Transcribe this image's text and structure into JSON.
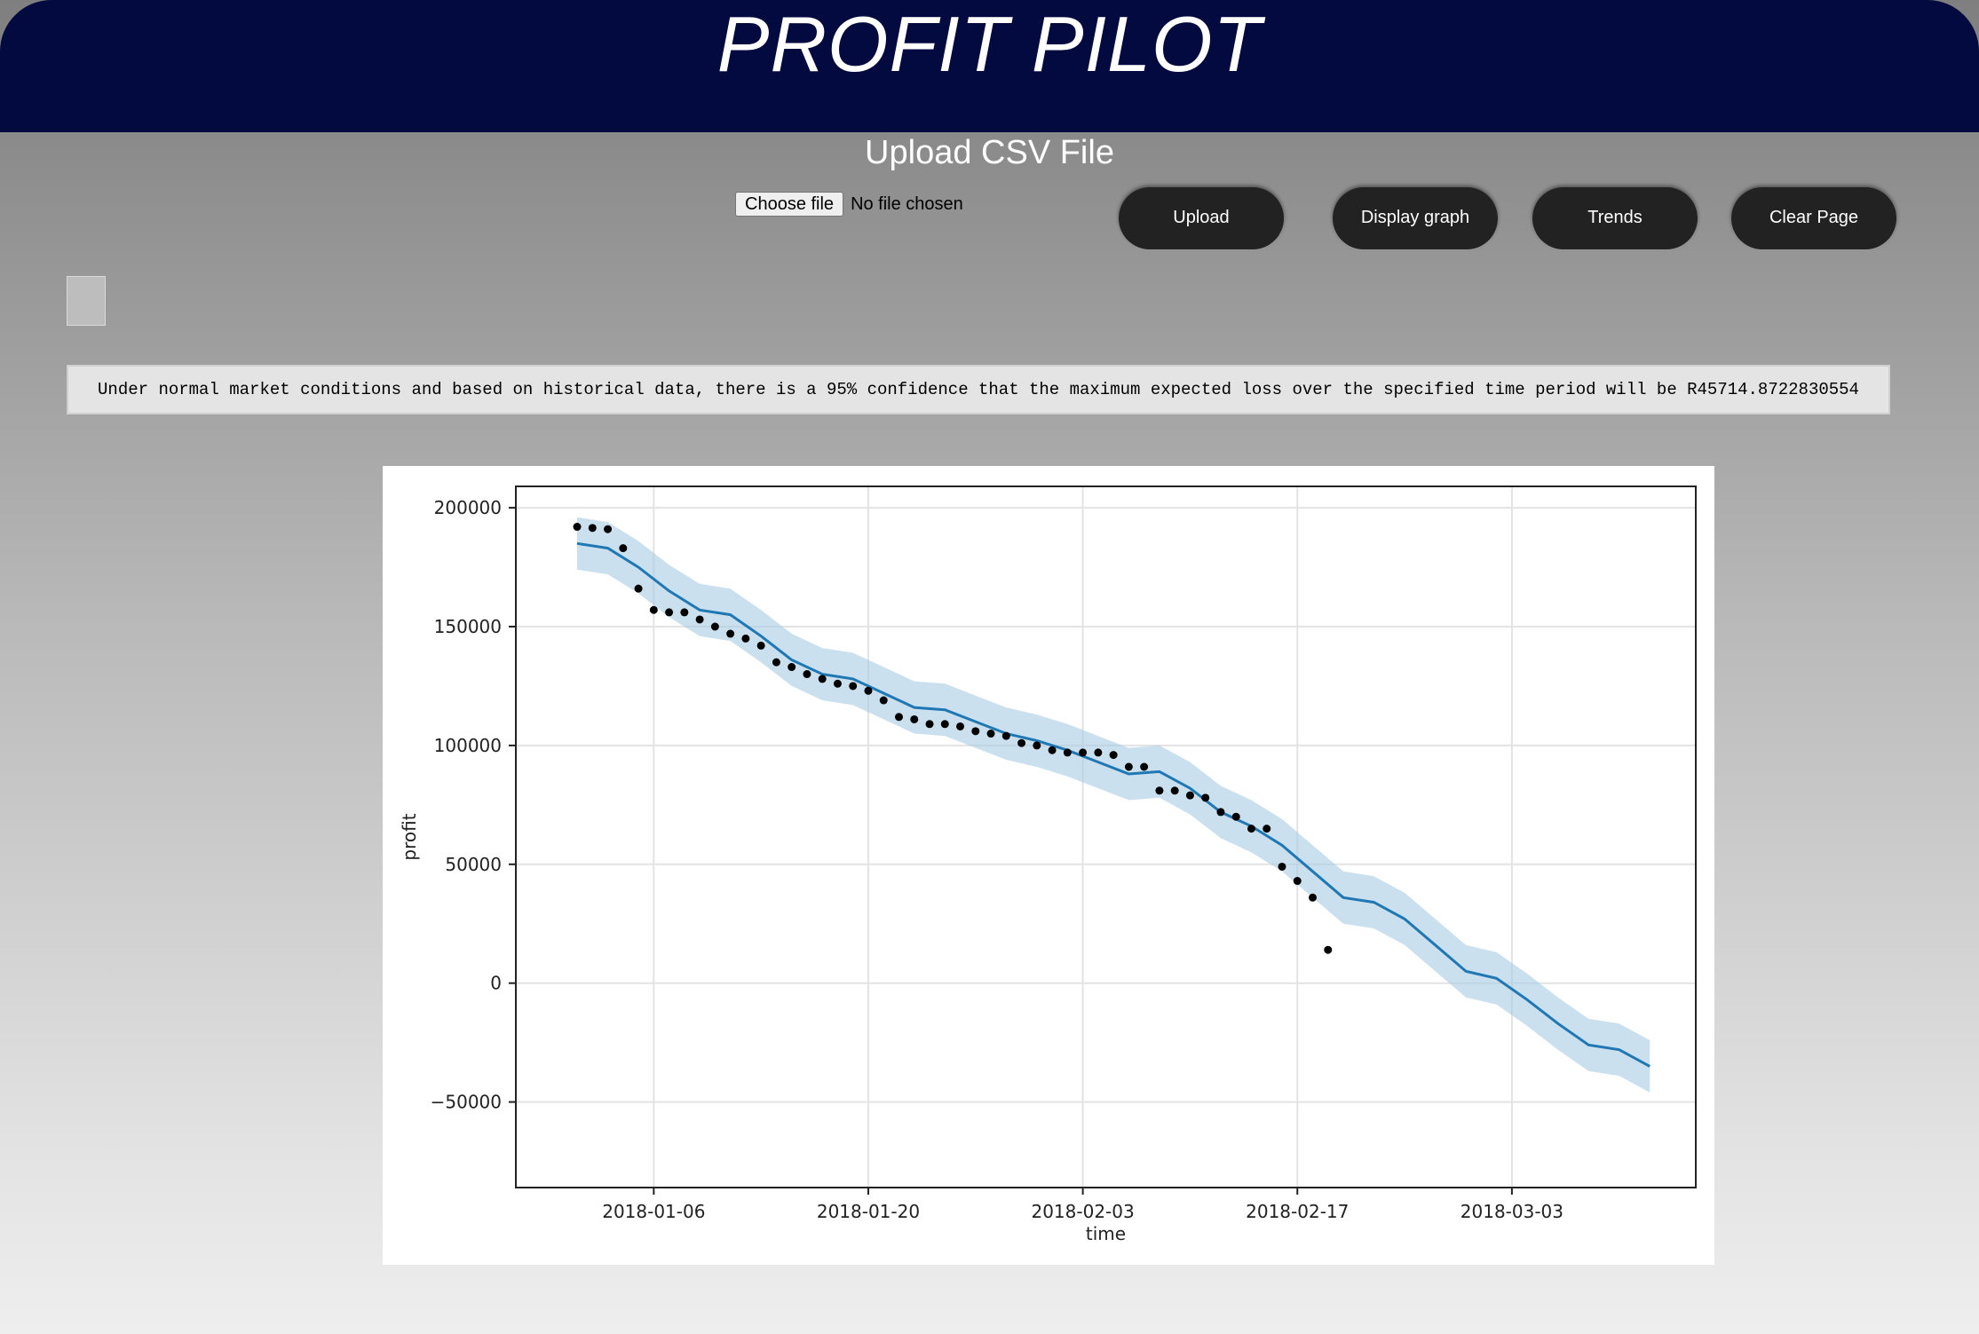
{
  "header": {
    "brand": "PROFIT PILOT"
  },
  "upload": {
    "title": "Upload CSV File",
    "choose_label": "Choose file",
    "no_file_text": "No file chosen"
  },
  "buttons": {
    "upload": "Upload",
    "display_graph": "Display graph",
    "trends": "Trends",
    "clear_page": "Clear Page"
  },
  "message": "Under normal market conditions and based on historical data, there is a 95% confidence that the maximum expected loss over the specified time period will be R45714.8722830554",
  "chart_data": {
    "type": "line",
    "xlabel": "time",
    "ylabel": "profit",
    "x_ticks": [
      "2018-01-06",
      "2018-01-20",
      "2018-02-03",
      "2018-02-17",
      "2018-03-03"
    ],
    "y_ticks": [
      200000,
      150000,
      100000,
      50000,
      0,
      -50000
    ],
    "ylim": [
      -86000,
      209000
    ],
    "xlim": [
      "2017-12-28",
      "2018-03-15"
    ],
    "grid": true,
    "colors": {
      "forecast": "#1f77b4",
      "interval": "#a6cbe3",
      "actual": "#000000"
    },
    "series": [
      {
        "values_kind": "actual",
        "x": [
          "2018-01-01",
          "2018-01-02",
          "2018-01-03",
          "2018-01-04",
          "2018-01-05",
          "2018-01-06",
          "2018-01-07",
          "2018-01-08",
          "2018-01-09",
          "2018-01-10",
          "2018-01-11",
          "2018-01-12",
          "2018-01-13",
          "2018-01-14",
          "2018-01-15",
          "2018-01-16",
          "2018-01-17",
          "2018-01-18",
          "2018-01-19",
          "2018-01-20",
          "2018-01-21",
          "2018-01-22",
          "2018-01-23",
          "2018-01-24",
          "2018-01-25",
          "2018-01-26",
          "2018-01-27",
          "2018-01-28",
          "2018-01-29",
          "2018-01-30",
          "2018-01-31",
          "2018-02-01",
          "2018-02-02",
          "2018-02-03",
          "2018-02-04",
          "2018-02-05",
          "2018-02-06",
          "2018-02-07",
          "2018-02-08",
          "2018-02-09",
          "2018-02-10",
          "2018-02-11",
          "2018-02-12",
          "2018-02-13",
          "2018-02-14",
          "2018-02-15",
          "2018-02-16",
          "2018-02-17",
          "2018-02-18",
          "2018-02-19"
        ],
        "y": [
          192000,
          191500,
          191000,
          183000,
          166000,
          157000,
          156000,
          156000,
          153000,
          150000,
          147000,
          145000,
          142000,
          135000,
          133000,
          130000,
          128000,
          126000,
          125000,
          123000,
          119000,
          112000,
          111000,
          109000,
          109000,
          108000,
          106000,
          105000,
          104000,
          101000,
          100000,
          98000,
          97000,
          97000,
          97000,
          96000,
          91000,
          91000,
          81000,
          81000,
          79000,
          78000,
          72000,
          70000,
          65000,
          65000,
          49000,
          43000,
          36000,
          14000
        ]
      },
      {
        "values_kind": "forecast",
        "x": [
          "2018-01-01",
          "2018-01-03",
          "2018-01-05",
          "2018-01-07",
          "2018-01-09",
          "2018-01-11",
          "2018-01-13",
          "2018-01-15",
          "2018-01-17",
          "2018-01-19",
          "2018-01-21",
          "2018-01-23",
          "2018-01-25",
          "2018-01-27",
          "2018-01-29",
          "2018-01-31",
          "2018-02-02",
          "2018-02-04",
          "2018-02-06",
          "2018-02-08",
          "2018-02-10",
          "2018-02-12",
          "2018-02-14",
          "2018-02-16",
          "2018-02-18",
          "2018-02-20",
          "2018-02-22",
          "2018-02-24",
          "2018-02-26",
          "2018-02-28",
          "2018-03-02",
          "2018-03-04",
          "2018-03-06",
          "2018-03-08",
          "2018-03-10",
          "2018-03-12"
        ],
        "y": [
          185000,
          183000,
          175000,
          165000,
          157000,
          155000,
          146000,
          136000,
          130000,
          128000,
          122000,
          116000,
          115000,
          110000,
          105000,
          102000,
          98000,
          93000,
          88000,
          89000,
          82000,
          72000,
          66000,
          58000,
          47000,
          36000,
          34000,
          27000,
          16000,
          5000,
          2000,
          -7000,
          -17000,
          -26000,
          -28000,
          -35000
        ],
        "upper": [
          196000,
          194000,
          186000,
          176000,
          168000,
          166000,
          157000,
          147000,
          141000,
          139000,
          133000,
          127000,
          126000,
          121000,
          116000,
          113000,
          109000,
          104000,
          99000,
          100000,
          93000,
          83000,
          77000,
          69000,
          58000,
          47000,
          45000,
          38000,
          27000,
          16000,
          13000,
          4000,
          -6000,
          -15000,
          -17000,
          -24000
        ],
        "lower": [
          174000,
          172000,
          164000,
          154000,
          146000,
          144000,
          135000,
          125000,
          119000,
          117000,
          111000,
          105000,
          104000,
          99000,
          94000,
          91000,
          87000,
          82000,
          77000,
          78000,
          71000,
          61000,
          55000,
          47000,
          36000,
          25000,
          23000,
          16000,
          5000,
          -6000,
          -9000,
          -18000,
          -28000,
          -37000,
          -39000,
          -46000
        ]
      }
    ]
  }
}
